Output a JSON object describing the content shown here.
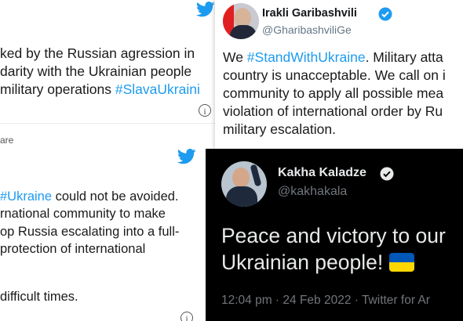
{
  "tweets": {
    "top_left": {
      "lines": [
        "ked by the Russian agression in",
        "darity with the Ukrainian people",
        "military operations "
      ],
      "hashtag": "#SlavaUkraini",
      "share": "are"
    },
    "top_right": {
      "name": "Irakli Garibashvili",
      "handle": "@GharibashviliGe",
      "line1_prefix": "We ",
      "line1_hashtag": "#StandWithUkraine",
      "line1_suffix": ". Military atta",
      "lines": [
        "country is unacceptable. We call on i",
        "community to apply all possible mea",
        "violation of international order by Ru",
        "military escalation."
      ]
    },
    "bottom_left": {
      "line1_hashtag": "#Ukraine",
      "line1_suffix": " could not be avoided.",
      "lines": [
        "rnational community to make",
        "op Russia escalating into a full-",
        " protection of international",
        "",
        " difficult times."
      ]
    },
    "bottom_right": {
      "name": "Kakha Kaladze",
      "handle": "@kakhakala",
      "text_line1": "Peace and victory to our",
      "text_line2": "Ukrainian people! ",
      "meta": "12:04 pm · 24 Feb 2022 · Twitter for Ar"
    }
  },
  "colors": {
    "accent": "#1d9bf0",
    "dark_bg": "#000000",
    "flag_blue": "#0057b7",
    "flag_yellow": "#ffd700"
  },
  "icons": [
    "twitter-bird-icon",
    "verified-badge-icon",
    "info-icon"
  ]
}
